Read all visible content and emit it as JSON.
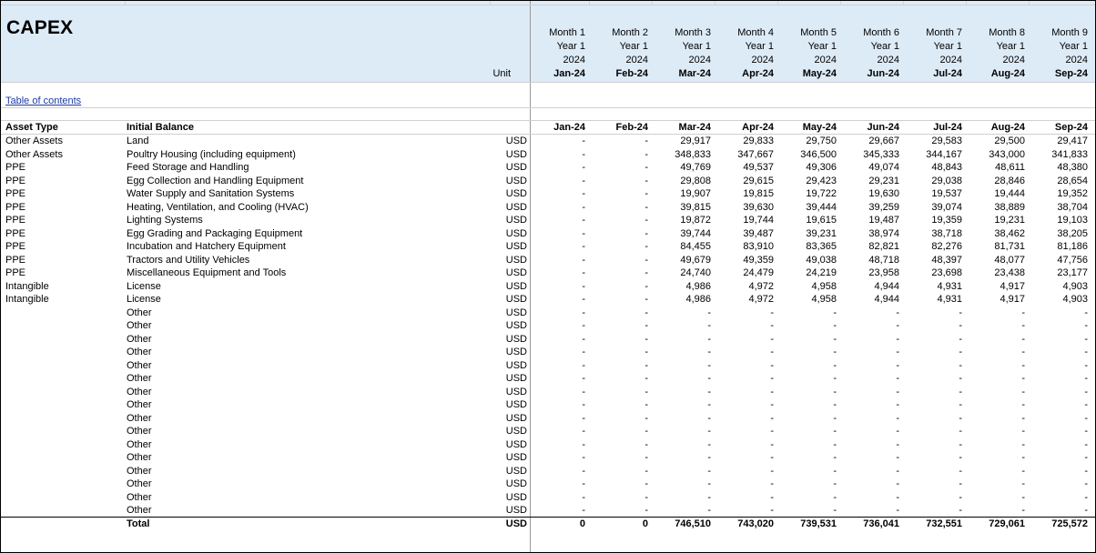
{
  "title": "CAPEX",
  "unit_label": "Unit",
  "toc_link": "Table of contents",
  "months": [
    {
      "month": "Month 1",
      "year": "Year 1",
      "fy": "2024",
      "date": "Jan-24"
    },
    {
      "month": "Month 2",
      "year": "Year 1",
      "fy": "2024",
      "date": "Feb-24"
    },
    {
      "month": "Month 3",
      "year": "Year 1",
      "fy": "2024",
      "date": "Mar-24"
    },
    {
      "month": "Month 4",
      "year": "Year 1",
      "fy": "2024",
      "date": "Apr-24"
    },
    {
      "month": "Month 5",
      "year": "Year 1",
      "fy": "2024",
      "date": "May-24"
    },
    {
      "month": "Month 6",
      "year": "Year 1",
      "fy": "2024",
      "date": "Jun-24"
    },
    {
      "month": "Month 7",
      "year": "Year 1",
      "fy": "2024",
      "date": "Jul-24"
    },
    {
      "month": "Month 8",
      "year": "Year 1",
      "fy": "2024",
      "date": "Aug-24"
    },
    {
      "month": "Month 9",
      "year": "Year 1",
      "fy": "2024",
      "date": "Sep-24"
    }
  ],
  "table": {
    "header": {
      "asset_type": "Asset Type",
      "name": "Initial Balance",
      "unit": ""
    },
    "column_dates": [
      "Jan-24",
      "Feb-24",
      "Mar-24",
      "Apr-24",
      "May-24",
      "Jun-24",
      "Jul-24",
      "Aug-24",
      "Sep-24"
    ],
    "rows": [
      {
        "type": "Other Assets",
        "name": "Land",
        "unit": "USD",
        "values": [
          "-",
          "-",
          "29,917",
          "29,833",
          "29,750",
          "29,667",
          "29,583",
          "29,500",
          "29,417"
        ]
      },
      {
        "type": "Other Assets",
        "name": "Poultry Housing (including equipment)",
        "unit": "USD",
        "values": [
          "-",
          "-",
          "348,833",
          "347,667",
          "346,500",
          "345,333",
          "344,167",
          "343,000",
          "341,833"
        ]
      },
      {
        "type": "PPE",
        "name": "Feed Storage and Handling",
        "unit": "USD",
        "values": [
          "-",
          "-",
          "49,769",
          "49,537",
          "49,306",
          "49,074",
          "48,843",
          "48,611",
          "48,380"
        ]
      },
      {
        "type": "PPE",
        "name": "Egg Collection and Handling Equipment",
        "unit": "USD",
        "values": [
          "-",
          "-",
          "29,808",
          "29,615",
          "29,423",
          "29,231",
          "29,038",
          "28,846",
          "28,654"
        ]
      },
      {
        "type": "PPE",
        "name": "Water Supply and Sanitation Systems",
        "unit": "USD",
        "values": [
          "-",
          "-",
          "19,907",
          "19,815",
          "19,722",
          "19,630",
          "19,537",
          "19,444",
          "19,352"
        ]
      },
      {
        "type": "PPE",
        "name": "Heating, Ventilation, and Cooling (HVAC)",
        "unit": "USD",
        "values": [
          "-",
          "-",
          "39,815",
          "39,630",
          "39,444",
          "39,259",
          "39,074",
          "38,889",
          "38,704"
        ]
      },
      {
        "type": "PPE",
        "name": "Lighting Systems",
        "unit": "USD",
        "values": [
          "-",
          "-",
          "19,872",
          "19,744",
          "19,615",
          "19,487",
          "19,359",
          "19,231",
          "19,103"
        ]
      },
      {
        "type": "PPE",
        "name": "Egg Grading and Packaging Equipment",
        "unit": "USD",
        "values": [
          "-",
          "-",
          "39,744",
          "39,487",
          "39,231",
          "38,974",
          "38,718",
          "38,462",
          "38,205"
        ]
      },
      {
        "type": "PPE",
        "name": "Incubation and Hatchery Equipment",
        "unit": "USD",
        "values": [
          "-",
          "-",
          "84,455",
          "83,910",
          "83,365",
          "82,821",
          "82,276",
          "81,731",
          "81,186"
        ]
      },
      {
        "type": "PPE",
        "name": "Tractors and Utility Vehicles",
        "unit": "USD",
        "values": [
          "-",
          "-",
          "49,679",
          "49,359",
          "49,038",
          "48,718",
          "48,397",
          "48,077",
          "47,756"
        ]
      },
      {
        "type": "PPE",
        "name": "Miscellaneous Equipment and Tools",
        "unit": "USD",
        "values": [
          "-",
          "-",
          "24,740",
          "24,479",
          "24,219",
          "23,958",
          "23,698",
          "23,438",
          "23,177"
        ]
      },
      {
        "type": "Intangible",
        "name": "License",
        "unit": "USD",
        "values": [
          "-",
          "-",
          "4,986",
          "4,972",
          "4,958",
          "4,944",
          "4,931",
          "4,917",
          "4,903"
        ]
      },
      {
        "type": "Intangible",
        "name": "License",
        "unit": "USD",
        "values": [
          "-",
          "-",
          "4,986",
          "4,972",
          "4,958",
          "4,944",
          "4,931",
          "4,917",
          "4,903"
        ]
      },
      {
        "type": "",
        "name": "Other",
        "unit": "USD",
        "values": [
          "-",
          "-",
          "-",
          "-",
          "-",
          "-",
          "-",
          "-",
          "-"
        ]
      },
      {
        "type": "",
        "name": "Other",
        "unit": "USD",
        "values": [
          "-",
          "-",
          "-",
          "-",
          "-",
          "-",
          "-",
          "-",
          "-"
        ]
      },
      {
        "type": "",
        "name": "Other",
        "unit": "USD",
        "values": [
          "-",
          "-",
          "-",
          "-",
          "-",
          "-",
          "-",
          "-",
          "-"
        ]
      },
      {
        "type": "",
        "name": "Other",
        "unit": "USD",
        "values": [
          "-",
          "-",
          "-",
          "-",
          "-",
          "-",
          "-",
          "-",
          "-"
        ]
      },
      {
        "type": "",
        "name": "Other",
        "unit": "USD",
        "values": [
          "-",
          "-",
          "-",
          "-",
          "-",
          "-",
          "-",
          "-",
          "-"
        ]
      },
      {
        "type": "",
        "name": "Other",
        "unit": "USD",
        "values": [
          "-",
          "-",
          "-",
          "-",
          "-",
          "-",
          "-",
          "-",
          "-"
        ]
      },
      {
        "type": "",
        "name": "Other",
        "unit": "USD",
        "values": [
          "-",
          "-",
          "-",
          "-",
          "-",
          "-",
          "-",
          "-",
          "-"
        ]
      },
      {
        "type": "",
        "name": "Other",
        "unit": "USD",
        "values": [
          "-",
          "-",
          "-",
          "-",
          "-",
          "-",
          "-",
          "-",
          "-"
        ]
      },
      {
        "type": "",
        "name": "Other",
        "unit": "USD",
        "values": [
          "-",
          "-",
          "-",
          "-",
          "-",
          "-",
          "-",
          "-",
          "-"
        ]
      },
      {
        "type": "",
        "name": "Other",
        "unit": "USD",
        "values": [
          "-",
          "-",
          "-",
          "-",
          "-",
          "-",
          "-",
          "-",
          "-"
        ]
      },
      {
        "type": "",
        "name": "Other",
        "unit": "USD",
        "values": [
          "-",
          "-",
          "-",
          "-",
          "-",
          "-",
          "-",
          "-",
          "-"
        ]
      },
      {
        "type": "",
        "name": "Other",
        "unit": "USD",
        "values": [
          "-",
          "-",
          "-",
          "-",
          "-",
          "-",
          "-",
          "-",
          "-"
        ]
      },
      {
        "type": "",
        "name": "Other",
        "unit": "USD",
        "values": [
          "-",
          "-",
          "-",
          "-",
          "-",
          "-",
          "-",
          "-",
          "-"
        ]
      },
      {
        "type": "",
        "name": "Other",
        "unit": "USD",
        "values": [
          "-",
          "-",
          "-",
          "-",
          "-",
          "-",
          "-",
          "-",
          "-"
        ]
      },
      {
        "type": "",
        "name": "Other",
        "unit": "USD",
        "values": [
          "-",
          "-",
          "-",
          "-",
          "-",
          "-",
          "-",
          "-",
          "-"
        ]
      },
      {
        "type": "",
        "name": "Other",
        "unit": "USD",
        "values": [
          "-",
          "-",
          "-",
          "-",
          "-",
          "-",
          "-",
          "-",
          "-"
        ]
      }
    ],
    "total": {
      "name": "Total",
      "unit": "USD",
      "values": [
        "0",
        "0",
        "746,510",
        "743,020",
        "739,531",
        "736,041",
        "732,551",
        "729,061",
        "725,572"
      ]
    }
  }
}
